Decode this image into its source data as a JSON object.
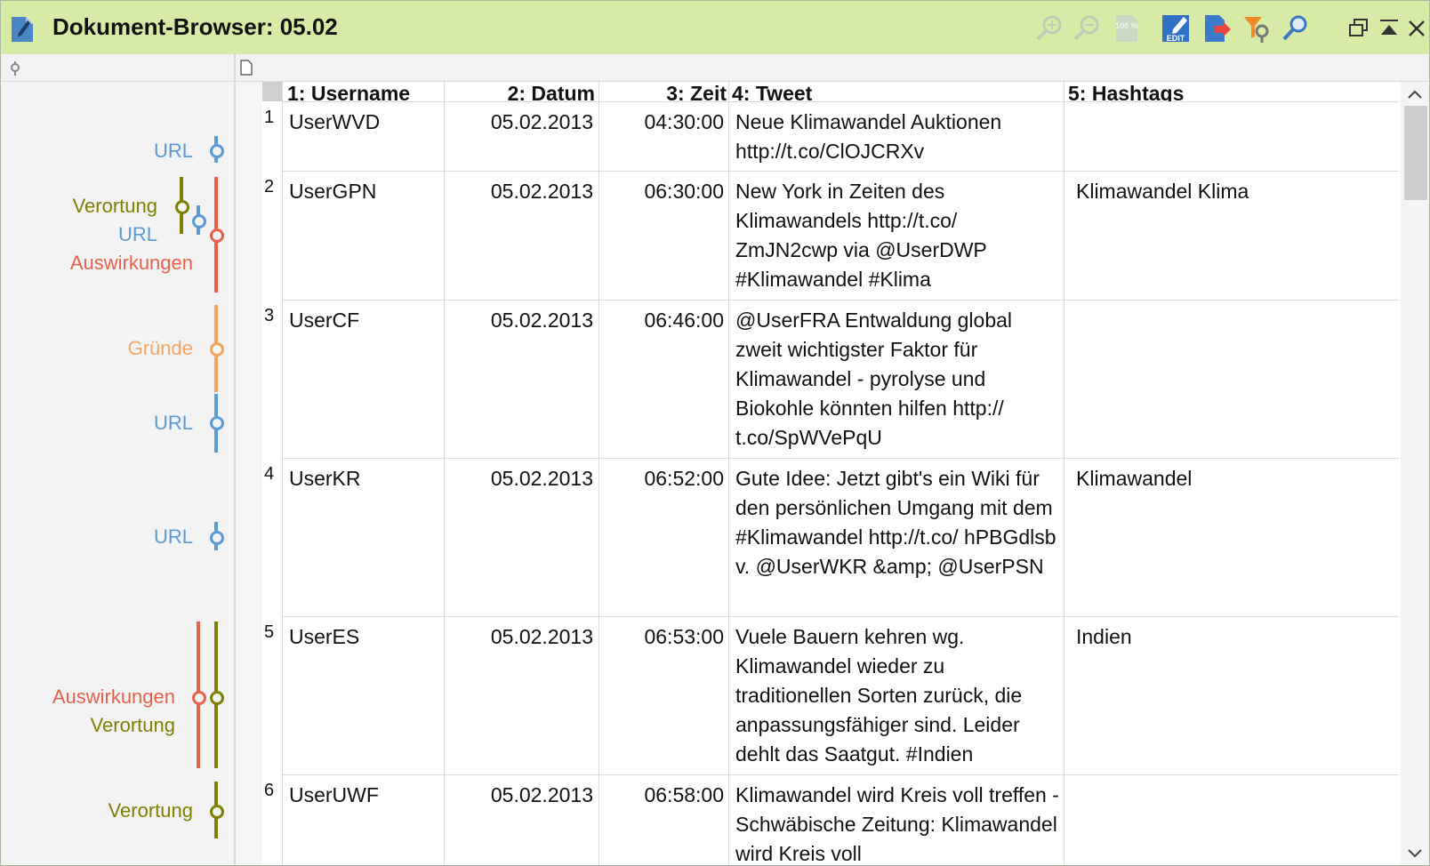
{
  "title": "Dokument-Browser: 05.02",
  "colors": {
    "url": "#5b9bd5",
    "verortung": "#808000",
    "auswirkungen": "#e8604c",
    "gruende": "#f4a460"
  },
  "toolbar": {
    "icons": [
      "zoom-in-icon",
      "zoom-out-icon",
      "zoom-100-icon",
      "edit-icon",
      "export-icon",
      "filter-icon",
      "search-icon"
    ],
    "edit_label": "EDIT",
    "zoom100_label": "100 %"
  },
  "window_controls": [
    "restore-icon",
    "collapse-icon",
    "close-icon"
  ],
  "columns": [
    "1: Username",
    "2: Datum",
    "3: Zeit",
    "4: Tweet",
    "5: Hashtags"
  ],
  "rows": [
    {
      "num": "1",
      "username": "UserWVD",
      "date": "05.02.2013",
      "time": "04:30:00",
      "tweet": "Neue Klimawandel Auktionen http://t.co/ClOJCRXv",
      "hashtags": ""
    },
    {
      "num": "2",
      "username": "UserGPN",
      "date": "05.02.2013",
      "time": "06:30:00",
      "tweet": "New York in Zeiten des Klimawandels http://t.co/ ZmJN2cwp via @UserDWP #Klimawandel #Klima",
      "hashtags": "Klimawandel Klima"
    },
    {
      "num": "3",
      "username": "UserCF",
      "date": "05.02.2013",
      "time": "06:46:00",
      "tweet": "@UserFRA Entwaldung global zweit wichtigster Faktor für Klimawandel - pyrolyse und Biokohle könnten hilfen http:// t.co/SpWVePqU",
      "hashtags": ""
    },
    {
      "num": "4",
      "username": "UserKR",
      "date": "05.02.2013",
      "time": "06:52:00",
      "tweet": "Gute Idee: Jetzt gibt's ein Wiki für den persönlichen Umgang mit dem #Klimawandel http://t.co/ hPBGdlsb v. @UserWKR &amp; @UserPSN",
      "hashtags": "Klimawandel"
    },
    {
      "num": "5",
      "username": "UserES",
      "date": "05.02.2013",
      "time": "06:53:00",
      "tweet": "Vuele Bauern kehren wg. Klimawandel wieder zu traditionellen Sorten zurück, die anpassungsfähiger sind. Leider dehlt das Saatgut. #Indien",
      "hashtags": "Indien"
    },
    {
      "num": "6",
      "username": "UserUWF",
      "date": "05.02.2013",
      "time": "06:58:00",
      "tweet": "Klimawandel wird Kreis voll treffen - Schwäbische Zeitung: Klimawandel wird Kreis voll",
      "hashtags": ""
    }
  ],
  "codes": [
    {
      "label": "URL",
      "color_key": "url"
    },
    {
      "label": "Verortung",
      "color_key": "verortung"
    },
    {
      "label": "URL",
      "color_key": "url"
    },
    {
      "label": "Auswirkungen",
      "color_key": "auswirkungen"
    },
    {
      "label": "Gründe",
      "color_key": "gruende"
    },
    {
      "label": "URL",
      "color_key": "url"
    },
    {
      "label": "URL",
      "color_key": "url"
    },
    {
      "label": "Auswirkungen",
      "color_key": "auswirkungen"
    },
    {
      "label": "Verortung",
      "color_key": "verortung"
    },
    {
      "label": "Verortung",
      "color_key": "verortung"
    }
  ]
}
